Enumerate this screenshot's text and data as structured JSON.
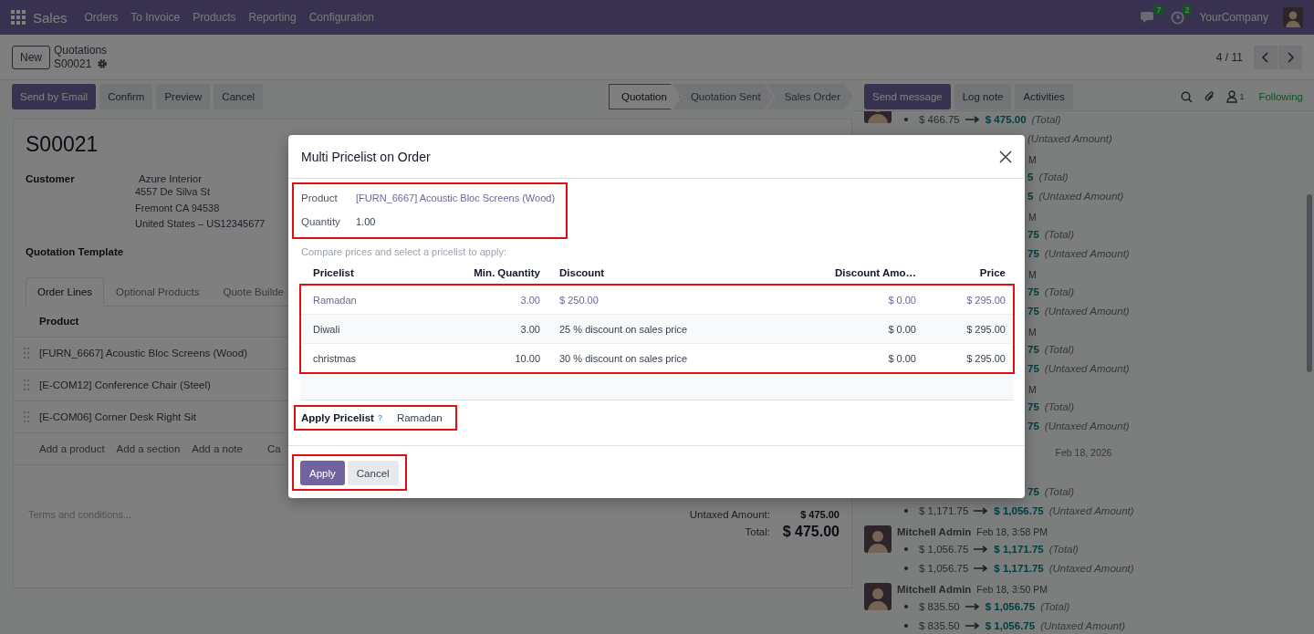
{
  "navbar": {
    "app": "Sales",
    "menu": [
      "Orders",
      "To Invoice",
      "Products",
      "Reporting",
      "Configuration"
    ],
    "messages_badge": "7",
    "activities_badge": "2",
    "company": "YourCompany"
  },
  "control_panel": {
    "new_button": "New",
    "breadcrumb": "Quotations",
    "record": "S00021",
    "pager": "4 / 11"
  },
  "actions": [
    {
      "label": "Send by Email",
      "kind": "primary"
    },
    {
      "label": "Confirm",
      "kind": "secondary"
    },
    {
      "label": "Preview",
      "kind": "secondary"
    },
    {
      "label": "Cancel",
      "kind": "secondary"
    }
  ],
  "statusbar": [
    {
      "label": "Quotation",
      "selected": true
    },
    {
      "label": "Quotation Sent",
      "selected": false
    },
    {
      "label": "Sales Order",
      "selected": false
    }
  ],
  "form": {
    "title": "S00021",
    "customer_label": "Customer",
    "customer_name": "Azure Interior",
    "address": [
      "4557 De Silva St",
      "Fremont CA 94538",
      "United States – US12345677"
    ],
    "template_label": "Quotation Template",
    "tabs": [
      {
        "label": "Order Lines",
        "selected": true
      },
      {
        "label": "Optional Products",
        "selected": false
      },
      {
        "label": "Quote Builde",
        "selected": false
      }
    ],
    "table": {
      "columns": [
        "Product"
      ],
      "rows": [
        "[FURN_6667] Acoustic Bloc Screens (Wood)",
        "[E-COM12] Conference Chair (Steel)",
        "[E-COM06] Corner Desk Right Sit"
      ]
    },
    "add_links": [
      "Add a product",
      "Add a section",
      "Add a note",
      "Ca"
    ],
    "terms_placeholder": "Terms and conditions...",
    "totals": [
      {
        "label": "Untaxed Amount:",
        "value": "$ 475.00",
        "kind": "subtotal"
      },
      {
        "label": "Total:",
        "value": "$ 475.00",
        "kind": "total"
      }
    ]
  },
  "chatter": {
    "actions": [
      {
        "label": "Send message",
        "kind": "primary"
      },
      {
        "label": "Log note",
        "kind": "secondary"
      },
      {
        "label": "Activities",
        "kind": "secondary"
      }
    ],
    "followers_count": "1",
    "follow_status": "Following",
    "entries": [
      {
        "kind": "cut_top",
        "lines": [
          {
            "old": "$ 466.75",
            "new": "$ 475.00",
            "field": "(Total)"
          },
          {
            "field": "(Untaxed Amount)"
          }
        ]
      },
      {
        "kind": "covered",
        "time": "M",
        "lines": [
          {
            "new": "5",
            "field": "(Total)"
          },
          {
            "new": "5",
            "field": "(Untaxed Amount)"
          }
        ]
      },
      {
        "kind": "covered",
        "time": "M",
        "lines": [
          {
            "new": "75",
            "field": "(Total)"
          },
          {
            "new": "75",
            "field": "(Untaxed Amount)"
          }
        ]
      },
      {
        "kind": "covered",
        "time": "M",
        "lines": [
          {
            "new": "75",
            "field": "(Total)"
          },
          {
            "new": "75",
            "field": "(Untaxed Amount)"
          }
        ]
      },
      {
        "kind": "covered",
        "time": "M",
        "lines": [
          {
            "new": "75",
            "field": "(Total)"
          },
          {
            "new": "75",
            "field": "(Untaxed Amount)"
          }
        ]
      },
      {
        "kind": "covered",
        "time": "M",
        "lines": [
          {
            "new": "75",
            "field": "(Total)"
          },
          {
            "new": "75",
            "field": "(Untaxed Amount)"
          }
        ]
      },
      {
        "kind": "date",
        "label": "Feb 18, 2026"
      },
      {
        "kind": "covered",
        "lines": [
          {
            "new": "75",
            "field": "(Total)"
          },
          {
            "old": "$ 1,171.75",
            "new": "$ 1,056.75",
            "field": "(Untaxed Amount)"
          }
        ]
      },
      {
        "kind": "full",
        "author": "Mitchell Admin",
        "time": "Feb 18, 3:58 PM",
        "lines": [
          {
            "old": "$ 1,056.75",
            "new": "$ 1,171.75",
            "field": "(Total)"
          },
          {
            "old": "$ 1,056.75",
            "new": "$ 1,171.75",
            "field": "(Untaxed Amount)"
          }
        ]
      },
      {
        "kind": "full",
        "author": "Mitchell Admin",
        "time": "Feb 18, 3:50 PM",
        "lines": [
          {
            "old": "$ 835.50",
            "new": "$ 1,056.75",
            "field": "(Total)"
          },
          {
            "old": "$ 835.50",
            "new": "$ 1,056.75",
            "field": "(Untaxed Amount)"
          }
        ]
      }
    ]
  },
  "dialog": {
    "title": "Multi Pricelist on Order",
    "fields": [
      {
        "label": "Product",
        "value": "[FURN_6667] Acoustic Bloc Screens (Wood)",
        "kind": "link"
      },
      {
        "label": "Quantity",
        "value": "1.00",
        "kind": "text"
      }
    ],
    "hint": "Compare prices and select a pricelist to apply:",
    "columns": [
      "Pricelist",
      "Min. Quantity",
      "Discount",
      "Discount Amo…",
      "Price"
    ],
    "rows": [
      {
        "cells": [
          "Ramadan",
          "3.00",
          "$ 250.00",
          "$ 0.00",
          "$ 295.00"
        ],
        "selected": true
      },
      {
        "cells": [
          "Diwali",
          "3.00",
          "25 % discount on sales price",
          "$ 0.00",
          "$ 295.00"
        ],
        "selected": false
      },
      {
        "cells": [
          "christmas",
          "10.00",
          "30 % discount on sales price",
          "$ 0.00",
          "$ 295.00"
        ],
        "selected": false
      }
    ],
    "apply_field": {
      "label": "Apply Pricelist",
      "help": "?",
      "value": "Ramadan"
    },
    "buttons": [
      {
        "label": "Apply",
        "kind": "primary"
      },
      {
        "label": "Cancel",
        "kind": "secondary"
      }
    ]
  }
}
